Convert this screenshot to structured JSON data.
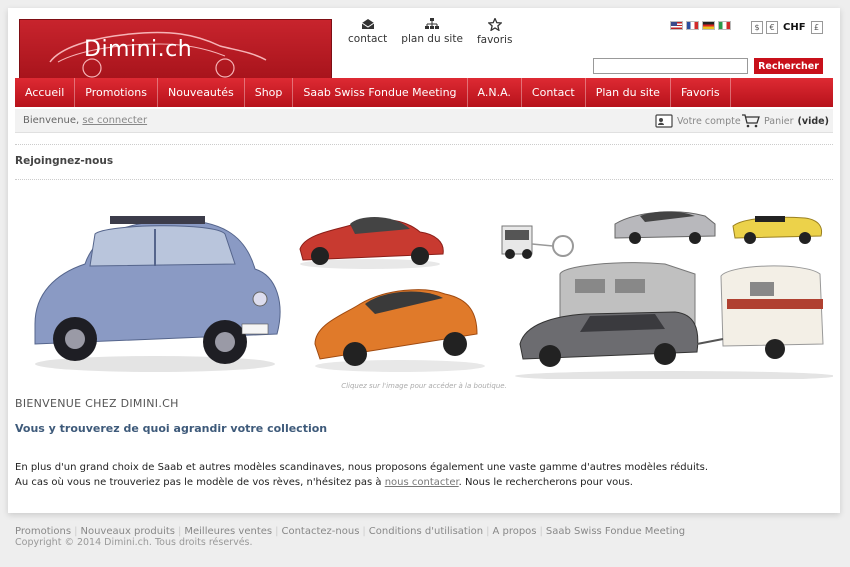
{
  "logo": {
    "text": "Dimini.ch"
  },
  "toplinks": [
    {
      "label": "contact",
      "icon": "envelope-icon"
    },
    {
      "label": "plan du site",
      "icon": "sitemap-icon"
    },
    {
      "label": "favoris",
      "icon": "star-icon"
    }
  ],
  "languages": [
    "en",
    "fr",
    "de",
    "it"
  ],
  "currency": {
    "options": [
      "$",
      "€",
      "£"
    ],
    "active": "CHF"
  },
  "search": {
    "placeholder": "",
    "button_label": "Rechercher"
  },
  "nav": [
    "Accueil",
    "Promotions",
    "Nouveautés",
    "Shop",
    "Saab Swiss Fondue Meeting",
    "A.N.A.",
    "Contact",
    "Plan du site",
    "Favoris"
  ],
  "userbar": {
    "welcome": "Bienvenue,",
    "login_link": "se connecter",
    "account_label": "Votre compte",
    "cart_label": "Panier",
    "cart_status": "(vide)"
  },
  "section_title": "Rejoingnez-nous",
  "banner_caption": "Cliquez sur l'image pour accéder à la boutique.",
  "welcome_heading": "BIENVENUE CHEZ DIMINI.CH",
  "collection_heading": "Vous y trouverez de quoi agrandir votre collection",
  "body": {
    "line1": "En plus d'un grand choix de Saab et autres modèles scandinaves, nous proposons également une vaste gamme d'autres modèles réduits.",
    "line2_pre": "Au cas où vous ne trouveriez pas le modèle de vos rèves, n'hésitez pas à ",
    "line2_link": "nous contacter",
    "line2_post": ". Nous le rechercherons pour vous."
  },
  "footer": {
    "links": [
      "Promotions",
      "Nouveaux produits",
      "Meilleures ventes",
      "Contactez-nous",
      "Conditions d'utilisation",
      "A propos",
      "Saab Swiss Fondue Meeting"
    ],
    "copyright": "Copyright © 2014 Dimini.ch. Tous droits réservés."
  },
  "colors": {
    "brand_red": "#c8101a",
    "heading_blue": "#3e5a7a"
  }
}
